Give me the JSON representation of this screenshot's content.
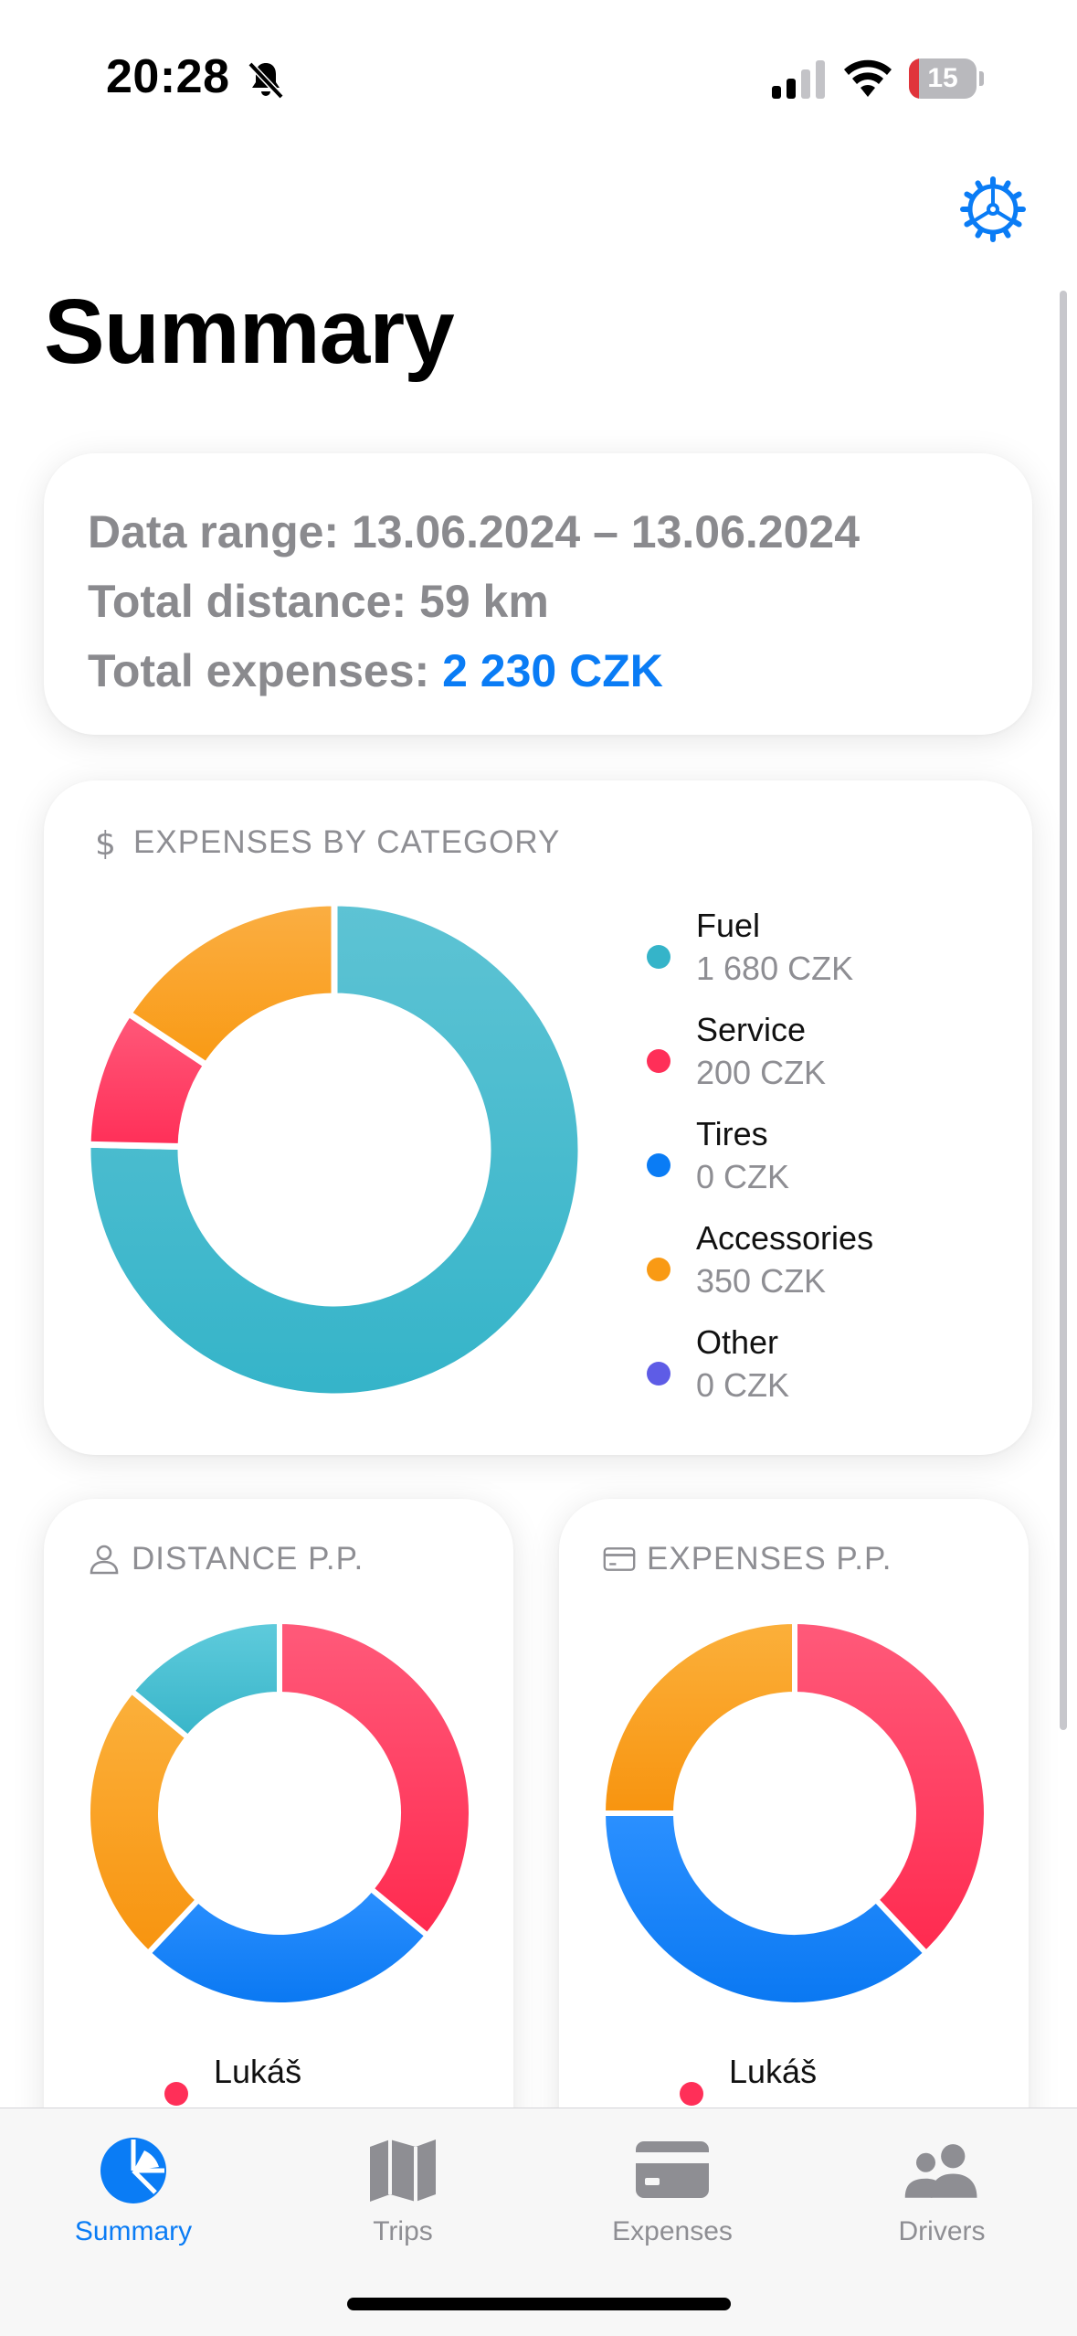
{
  "status_bar": {
    "time": "20:28",
    "battery_level": "15"
  },
  "header": {
    "title": "Summary"
  },
  "summary_card": {
    "data_range": "Data range: 13.06.2024 – 13.06.2024",
    "total_distance": "Total distance: 59 km",
    "total_expenses_label": "Total expenses: ",
    "total_expenses_value": "2 230 CZK"
  },
  "expenses_by_category": {
    "header": "EXPENSES BY CATEGORY",
    "items": [
      {
        "label": "Fuel",
        "value": "1 680 CZK",
        "amount": 1680,
        "color": "#35b4c9"
      },
      {
        "label": "Service",
        "value": "200 CZK",
        "amount": 200,
        "color": "#ff2f58"
      },
      {
        "label": "Tires",
        "value": "0 CZK",
        "amount": 0,
        "color": "#0a7cf5"
      },
      {
        "label": "Accessories",
        "value": "350 CZK",
        "amount": 350,
        "color": "#f99a14"
      },
      {
        "label": "Other",
        "value": "0 CZK",
        "amount": 0,
        "color": "#5e5ce6"
      }
    ]
  },
  "distance_pp": {
    "header": "DISTANCE P.P.",
    "first_legend": {
      "label": "Lukáš",
      "value": "",
      "color": "#ff2f58"
    }
  },
  "expenses_pp": {
    "header": "EXPENSES P.P.",
    "first_legend": {
      "label": "Lukáš",
      "value": "",
      "color": "#ff2f58"
    }
  },
  "tabs": [
    {
      "label": "Summary",
      "active": true,
      "icon": "chart-pie-icon"
    },
    {
      "label": "Trips",
      "active": false,
      "icon": "map-icon"
    },
    {
      "label": "Expenses",
      "active": false,
      "icon": "credit-card-icon"
    },
    {
      "label": "Drivers",
      "active": false,
      "icon": "people-icon"
    }
  ],
  "colors": {
    "accent": "#0a7cf5",
    "fuel": "#35b4c9",
    "service": "#ff2f58",
    "tires": "#0a7cf5",
    "accessories": "#f99a14",
    "other": "#5e5ce6"
  }
}
